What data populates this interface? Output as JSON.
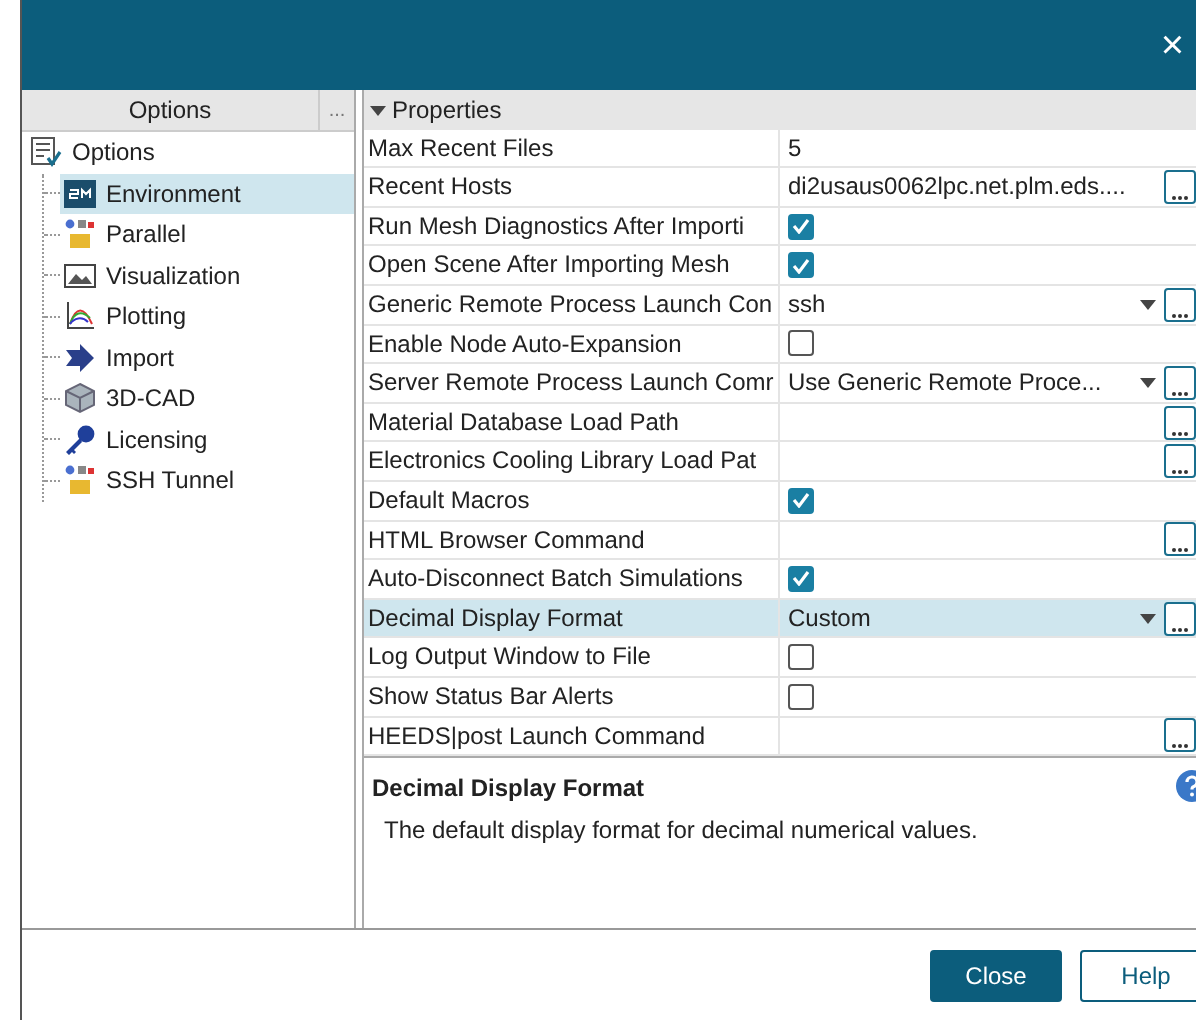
{
  "window": {
    "close_glyph": "×"
  },
  "sidebar": {
    "header": "Options",
    "header_more": "...",
    "root": {
      "label": "Options",
      "children": [
        {
          "label": "Environment",
          "selected": true
        },
        {
          "label": "Parallel",
          "selected": false
        },
        {
          "label": "Visualization",
          "selected": false
        },
        {
          "label": "Plotting",
          "selected": false
        },
        {
          "label": "Import",
          "selected": false
        },
        {
          "label": "3D-CAD",
          "selected": false
        },
        {
          "label": "Licensing",
          "selected": false
        },
        {
          "label": "SSH Tunnel",
          "selected": false
        }
      ]
    }
  },
  "properties": {
    "group": "Properties",
    "rows": [
      {
        "name": "Max Recent Files",
        "kind": "text",
        "value": "5",
        "browse": false,
        "selected": false
      },
      {
        "name": "Recent Hosts",
        "kind": "text",
        "value": "di2usaus0062lpc.net.plm.eds....",
        "browse": true,
        "selected": false
      },
      {
        "name": "Run Mesh Diagnostics After Importi",
        "kind": "checkbox",
        "checked": true,
        "browse": false,
        "selected": false
      },
      {
        "name": "Open Scene After Importing Mesh",
        "kind": "checkbox",
        "checked": true,
        "browse": false,
        "selected": false
      },
      {
        "name": "Generic Remote Process Launch Con",
        "kind": "dropdown",
        "value": "ssh",
        "browse": true,
        "selected": false
      },
      {
        "name": "Enable Node Auto-Expansion",
        "kind": "checkbox",
        "checked": false,
        "browse": false,
        "selected": false
      },
      {
        "name": "Server Remote Process Launch Comr",
        "kind": "dropdown",
        "value": "Use Generic Remote Proce...",
        "browse": true,
        "selected": false
      },
      {
        "name": "Material Database Load Path",
        "kind": "text",
        "browse": true,
        "selected": false
      },
      {
        "name": "Electronics Cooling Library Load Pat",
        "kind": "text",
        "browse": true,
        "selected": false
      },
      {
        "name": "Default Macros",
        "kind": "checkbox",
        "checked": true,
        "browse": false,
        "selected": false
      },
      {
        "name": "HTML Browser Command",
        "kind": "text",
        "browse": true,
        "selected": false
      },
      {
        "name": "Auto-Disconnect Batch Simulations",
        "kind": "checkbox",
        "checked": true,
        "browse": false,
        "selected": false
      },
      {
        "name": "Decimal Display Format",
        "kind": "dropdown",
        "value": "Custom",
        "browse": true,
        "selected": true
      },
      {
        "name": "Log Output Window to File",
        "kind": "checkbox",
        "checked": false,
        "browse": false,
        "selected": false
      },
      {
        "name": "Show Status Bar Alerts",
        "kind": "checkbox",
        "checked": false,
        "browse": false,
        "selected": false
      },
      {
        "name": "HEEDS|post Launch Command",
        "kind": "text",
        "browse": true,
        "selected": false
      }
    ]
  },
  "description": {
    "title": "Decimal Display Format",
    "text": "The default display format for decimal numerical values."
  },
  "buttons": [
    {
      "label": "Close",
      "primary": true
    },
    {
      "label": "Help",
      "primary": false
    }
  ]
}
